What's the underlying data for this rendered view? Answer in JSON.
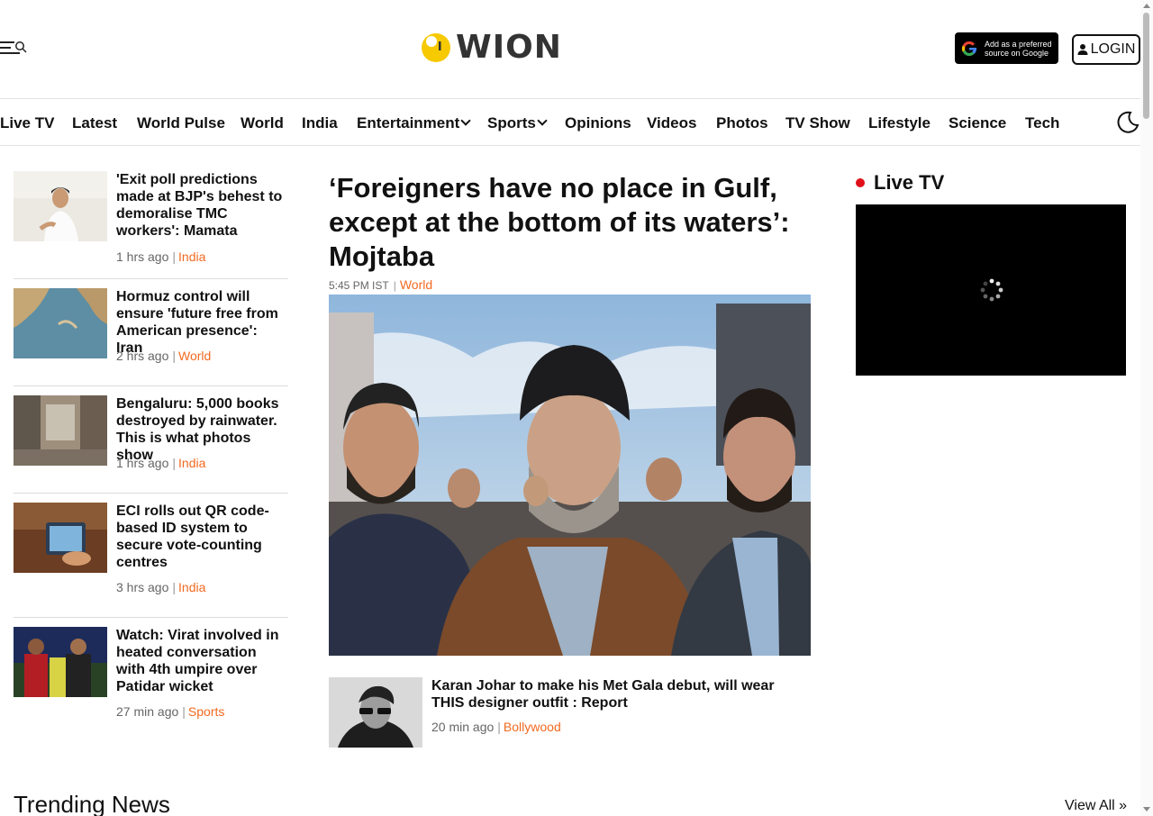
{
  "header": {
    "logo_text": "WION",
    "google_badge": "Add as a preferred source on Google",
    "login_label": "LOGIN"
  },
  "nav": {
    "items": [
      "Live TV",
      "Latest",
      "World Pulse",
      "World",
      "India",
      "Entertainment",
      "Sports",
      "Opinions",
      "Videos",
      "Photos",
      "TV Show",
      "Lifestyle",
      "Science",
      "Tech"
    ]
  },
  "sidebar_stories": [
    {
      "title": "'Exit poll predictions made at BJP's behest to demoralise TMC workers': Mamata",
      "time": "1 hrs ago",
      "category": "India"
    },
    {
      "title": "Hormuz control will ensure 'future free from American presence': Iran",
      "time": "2 hrs ago",
      "category": "World"
    },
    {
      "title": "Bengaluru: 5,000 books destroyed by rainwater. This is what photos show",
      "time": "1 hrs ago",
      "category": "India"
    },
    {
      "title": "ECI rolls out QR code-based ID system to secure vote-counting centres",
      "time": "3 hrs ago",
      "category": "India"
    },
    {
      "title": "Watch: Virat involved in heated conversation with 4th umpire over Patidar wicket",
      "time": "27 min ago",
      "category": "Sports"
    }
  ],
  "main": {
    "headline": "‘Foreigners have no place in Gulf, except at the bottom of its waters’: Mojtaba",
    "time": "5:45 PM IST",
    "category": "World",
    "sub_story": {
      "title": "Karan Johar to make his Met Gala debut, will wear THIS designer outfit : Report",
      "time": "20 min ago",
      "category": "Bollywood"
    }
  },
  "live": {
    "title": "Live TV"
  },
  "trending": {
    "title": "Trending News",
    "view_all": "View All »"
  },
  "colors": {
    "accent": "#f26a21",
    "live_dot": "#e0101a",
    "logo_yellow": "#f7c900"
  }
}
